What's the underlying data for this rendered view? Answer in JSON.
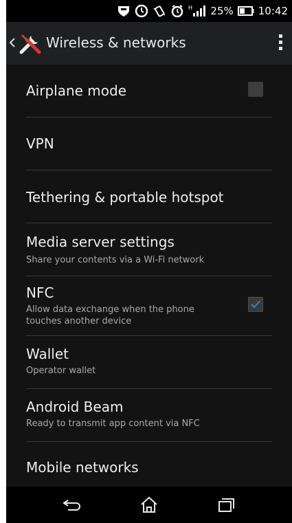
{
  "status_bar": {
    "battery_percent": "25%",
    "time": "10:42",
    "icons": [
      "shield-icon",
      "clock-icon",
      "vibrate-icon",
      "alarm-icon",
      "signal-icon",
      "battery-icon"
    ]
  },
  "action_bar": {
    "title": "Wireless & networks",
    "icons": [
      "back-chevron-icon",
      "tools-icon",
      "overflow-menu-icon"
    ]
  },
  "settings": {
    "items": [
      {
        "title": "Airplane mode",
        "subtitle": "",
        "checkbox": true,
        "checked": false
      },
      {
        "title": "VPN",
        "subtitle": ""
      },
      {
        "title": "Tethering & portable hotspot",
        "subtitle": ""
      },
      {
        "title": "Media server settings",
        "subtitle": "Share your contents via a Wi-Fi network"
      },
      {
        "title": "NFC",
        "subtitle": "Allow data exchange when the phone touches another device",
        "checkbox": true,
        "checked": true
      },
      {
        "title": "Wallet",
        "subtitle": "Operator wallet"
      },
      {
        "title": "Android Beam",
        "subtitle": "Ready to transmit app content via NFC"
      },
      {
        "title": "Mobile networks",
        "subtitle": ""
      }
    ]
  },
  "nav_bar": {
    "icons": [
      "back-icon",
      "home-icon",
      "recent-apps-icon"
    ]
  },
  "colors": {
    "action_bar_bg": "#1f2022",
    "list_bg": "#131313",
    "checkmark": "#3d7fc9"
  }
}
